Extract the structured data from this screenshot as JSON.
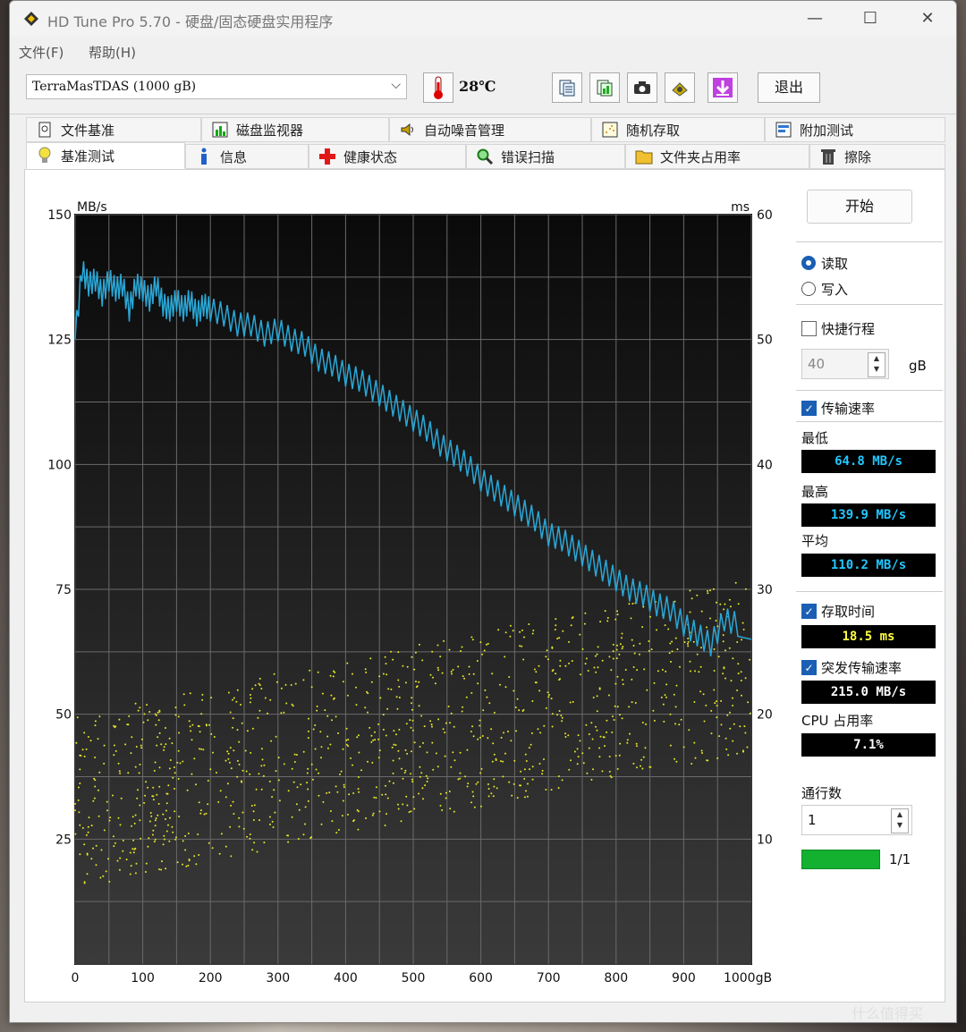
{
  "window": {
    "title": "HD Tune Pro 5.70 - 硬盘/固态硬盘实用程序",
    "min_glyph": "—",
    "max_glyph": "☐",
    "close_glyph": "✕"
  },
  "menu": [
    "文件(F)",
    "帮助(H)"
  ],
  "toolbar": {
    "drive": "TerraMasTDAS (1000 gB)",
    "temperature": "28℃",
    "exit_label": "退出",
    "icons": [
      "copy-text-icon",
      "copy-image-icon",
      "camera-icon",
      "options-icon",
      "save-down-icon"
    ]
  },
  "tabs": {
    "row1": [
      {
        "label": "文件基准",
        "icon": "file-benchmark-icon"
      },
      {
        "label": "磁盘监视器",
        "icon": "disk-monitor-icon"
      },
      {
        "label": "自动噪音管理",
        "icon": "speaker-icon"
      },
      {
        "label": "随机存取",
        "icon": "random-access-icon"
      },
      {
        "label": "附加测试",
        "icon": "extra-tests-icon"
      }
    ],
    "row2": [
      {
        "label": "基准测试",
        "icon": "benchmark-bulb-icon",
        "active": true
      },
      {
        "label": "信息",
        "icon": "info-icon"
      },
      {
        "label": "健康状态",
        "icon": "health-cross-icon"
      },
      {
        "label": "错误扫描",
        "icon": "magnifier-icon"
      },
      {
        "label": "文件夹占用率",
        "icon": "folder-icon"
      },
      {
        "label": "擦除",
        "icon": "trash-icon"
      }
    ]
  },
  "side": {
    "start_label": "开始",
    "read_label": "读取",
    "write_label": "写入",
    "mode": "read",
    "quick_label": "快捷行程",
    "quick_checked": false,
    "quick_value": "40",
    "quick_unit": "gB",
    "transfer_label": "传输速率",
    "transfer_checked": true,
    "min_label": "最低",
    "min_value": "64.8 MB/s",
    "max_label": "最高",
    "max_value": "139.9 MB/s",
    "avg_label": "平均",
    "avg_value": "110.2 MB/s",
    "access_label": "存取时间",
    "access_checked": true,
    "access_value": "18.5 ms",
    "burst_label": "突发传输速率",
    "burst_checked": true,
    "burst_value": "215.0 MB/s",
    "cpu_label": "CPU 占用率",
    "cpu_value": "7.1%",
    "passes_label": "通行数",
    "passes_value": "1",
    "progress_text": "1/1",
    "progress_fraction": 1.0
  },
  "chart_data": {
    "type": "line",
    "ylabel_left": "MB/s",
    "ylabel_right": "ms",
    "x_unit": "gB",
    "xlim": [
      0,
      1000
    ],
    "ylim_left": [
      0,
      150
    ],
    "ylim_right": [
      0,
      60
    ],
    "x_ticks": [
      "0",
      "100",
      "200",
      "300",
      "400",
      "500",
      "600",
      "700",
      "800",
      "900",
      "1000gB"
    ],
    "y_ticks_left": [
      "150",
      "125",
      "100",
      "75",
      "50",
      "25"
    ],
    "y_ticks_right": [
      "60",
      "50",
      "40",
      "30",
      "20",
      "10"
    ],
    "grid": true,
    "colors": {
      "transfer": "#2aa7d6",
      "access": "#e6e62a",
      "background_top": "#0a0a0a",
      "background_bottom": "#3a3a3a"
    },
    "series": [
      {
        "name": "传输速率",
        "x": [
          0,
          10,
          20,
          30,
          40,
          50,
          60,
          70,
          80,
          90,
          100,
          110,
          120,
          130,
          140,
          150,
          160,
          170,
          180,
          190,
          200,
          220,
          240,
          260,
          280,
          300,
          320,
          340,
          360,
          380,
          400,
          420,
          440,
          460,
          480,
          500,
          520,
          540,
          560,
          580,
          600,
          620,
          640,
          660,
          680,
          700,
          720,
          740,
          760,
          780,
          800,
          820,
          840,
          860,
          880,
          900,
          920,
          940,
          960,
          980,
          1000
        ],
        "y": [
          125,
          139,
          136,
          137,
          134,
          137,
          135,
          136,
          131,
          136,
          135,
          133,
          136,
          132,
          131,
          133,
          131,
          133,
          130,
          132,
          131,
          130,
          128,
          128,
          126,
          127,
          125,
          124,
          121,
          120,
          118,
          117,
          115,
          113,
          111,
          109,
          107,
          104,
          102,
          100,
          97,
          95,
          93,
          91,
          89,
          86,
          85,
          83,
          81,
          79,
          77,
          75,
          74,
          72,
          71,
          68,
          66,
          64,
          69,
          68,
          65
        ]
      },
      {
        "name": "存取时间",
        "type": "scatter",
        "x_range": [
          0,
          1000
        ],
        "y_range_ms": [
          5,
          27
        ],
        "approx_mean_ms": 18.5
      }
    ]
  },
  "watermark": "什么值得买"
}
